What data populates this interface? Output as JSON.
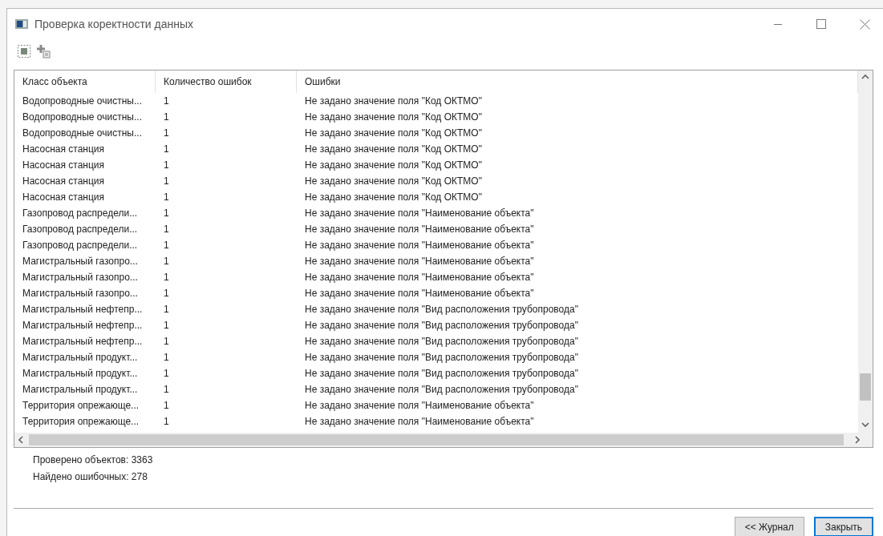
{
  "window": {
    "title": "Проверка коректности данных"
  },
  "table": {
    "columns": [
      "Класс объекта",
      "Количество ошибок",
      "Ошибки"
    ],
    "rows": [
      [
        "Водопроводные очистны...",
        "1",
        "Не задано значение поля \"Код ОКТМО\""
      ],
      [
        "Водопроводные очистны...",
        "1",
        "Не задано значение поля \"Код ОКТМО\""
      ],
      [
        "Водопроводные очистны...",
        "1",
        "Не задано значение поля \"Код ОКТМО\""
      ],
      [
        "Насосная станция",
        "1",
        "Не задано значение поля \"Код ОКТМО\""
      ],
      [
        "Насосная станция",
        "1",
        "Не задано значение поля \"Код ОКТМО\""
      ],
      [
        "Насосная станция",
        "1",
        "Не задано значение поля \"Код ОКТМО\""
      ],
      [
        "Насосная станция",
        "1",
        "Не задано значение поля \"Код ОКТМО\""
      ],
      [
        "Газопровод распредели...",
        "1",
        "Не задано значение поля \"Наименование объекта\""
      ],
      [
        "Газопровод распредели...",
        "1",
        "Не задано значение поля \"Наименование объекта\""
      ],
      [
        "Газопровод распредели...",
        "1",
        "Не задано значение поля \"Наименование объекта\""
      ],
      [
        "Магистральный газопро...",
        "1",
        "Не задано значение поля \"Наименование объекта\""
      ],
      [
        "Магистральный газопро...",
        "1",
        "Не задано значение поля \"Наименование объекта\""
      ],
      [
        "Магистральный газопро...",
        "1",
        "Не задано значение поля \"Наименование объекта\""
      ],
      [
        "Магистральный нефтепр...",
        "1",
        "Не задано значение поля \"Вид расположения трубопровода\""
      ],
      [
        "Магистральный нефтепр...",
        "1",
        "Не задано значение поля \"Вид расположения трубопровода\""
      ],
      [
        "Магистральный нефтепр...",
        "1",
        "Не задано значение поля \"Вид расположения трубопровода\""
      ],
      [
        "Магистральный продукт...",
        "1",
        "Не задано значение поля \"Вид расположения трубопровода\""
      ],
      [
        "Магистральный продукт...",
        "1",
        "Не задано значение поля \"Вид расположения трубопровода\""
      ],
      [
        "Магистральный продукт...",
        "1",
        "Не задано значение поля \"Вид расположения трубопровода\""
      ],
      [
        "Территория опрежающе...",
        "1",
        "Не задано значение поля \"Наименование объекта\""
      ],
      [
        "Территория опрежающе...",
        "1",
        "Не задано значение поля \"Наименование объекта\""
      ]
    ]
  },
  "summary": [
    "Проверено объектов: 3363",
    "Найдено ошибочных: 278"
  ],
  "buttons": [
    {
      "label": "<< Журнал",
      "kind": "normal"
    },
    {
      "label": "Закрыть",
      "kind": "default"
    }
  ]
}
